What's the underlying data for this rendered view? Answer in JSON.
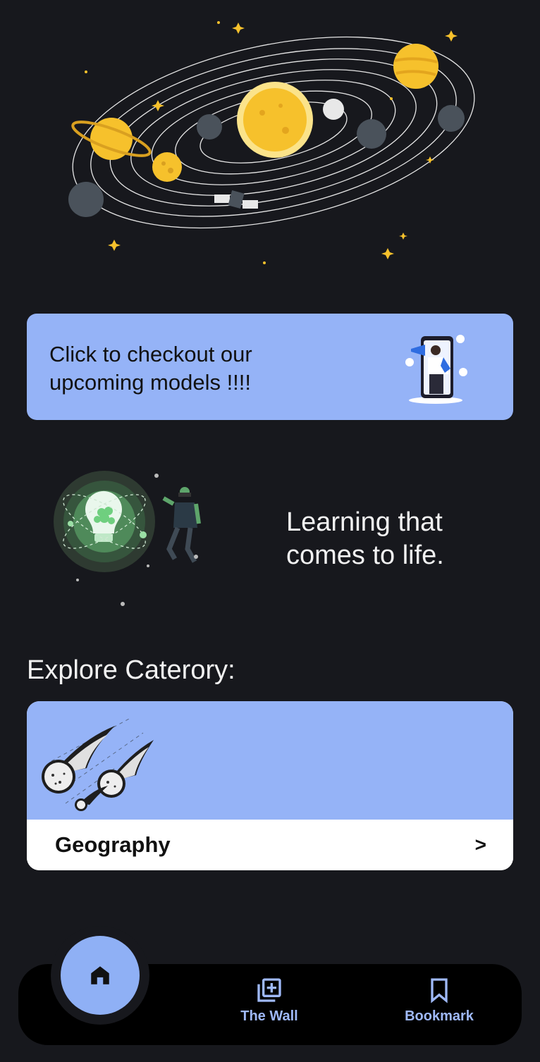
{
  "promo": {
    "text": "Click to checkout our upcoming models !!!!"
  },
  "tagline": {
    "text": "Learning that comes to life."
  },
  "explore": {
    "title": "Explore Caterory:",
    "categories": [
      {
        "label": "Geography",
        "arrow": ">"
      }
    ]
  },
  "nav": {
    "items": [
      {
        "icon": "home-icon"
      },
      {
        "label": "The Wall",
        "icon": "add-box-icon"
      },
      {
        "label": "Bookmark",
        "icon": "bookmark-icon"
      }
    ]
  },
  "colors": {
    "background": "#17181d",
    "accent": "#95b3f7",
    "nav_bar": "#000000",
    "nav_text": "#9fb9f9"
  }
}
